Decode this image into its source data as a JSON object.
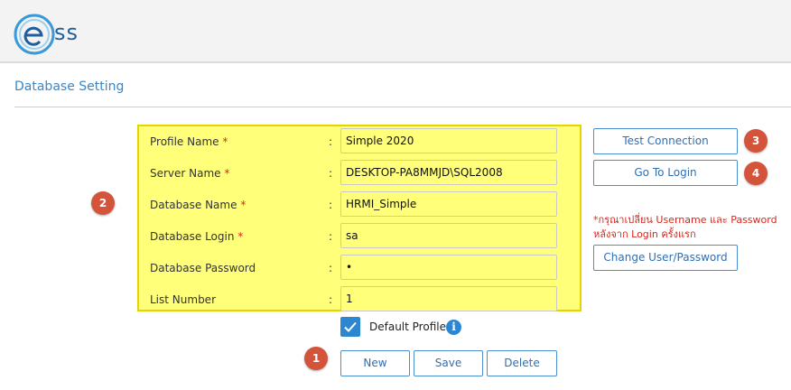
{
  "app": {
    "logo_text": "ss",
    "page_title": "Database Setting"
  },
  "form": {
    "fields": [
      {
        "label": "Profile Name",
        "required": true,
        "value": "Simple 2020"
      },
      {
        "label": "Server Name",
        "required": true,
        "value": "DESKTOP-PA8MMJD\\SQL2008"
      },
      {
        "label": "Database Name",
        "required": true,
        "value": "HRMI_Simple"
      },
      {
        "label": "Database Login",
        "required": true,
        "value": "sa"
      },
      {
        "label": "Database Password",
        "required": false,
        "value": "•"
      },
      {
        "label": "List Number",
        "required": false,
        "value": "1"
      }
    ],
    "required_mark": "*",
    "colon": ":"
  },
  "actions": {
    "test_connection": "Test Connection",
    "go_to_login": "Go To Login",
    "change_user": "Change User/Password",
    "note": "*กรุณาเปลี่ยน Username และ Password หลังจาก Login ครั้งแรก",
    "new": "New",
    "save": "Save",
    "delete": "Delete"
  },
  "default_profile": {
    "label": "Default Profile",
    "checked": true,
    "info_glyph": "i"
  },
  "badges": {
    "b1": "1",
    "b2": "2",
    "b3": "3",
    "b4": "4"
  },
  "colors": {
    "accent": "#2b87d1",
    "highlight": "#ffff7a",
    "badge": "#d4533b",
    "required": "#e0261d"
  },
  "icons": [
    "ess-logo-icon",
    "check-icon",
    "info-icon"
  ]
}
